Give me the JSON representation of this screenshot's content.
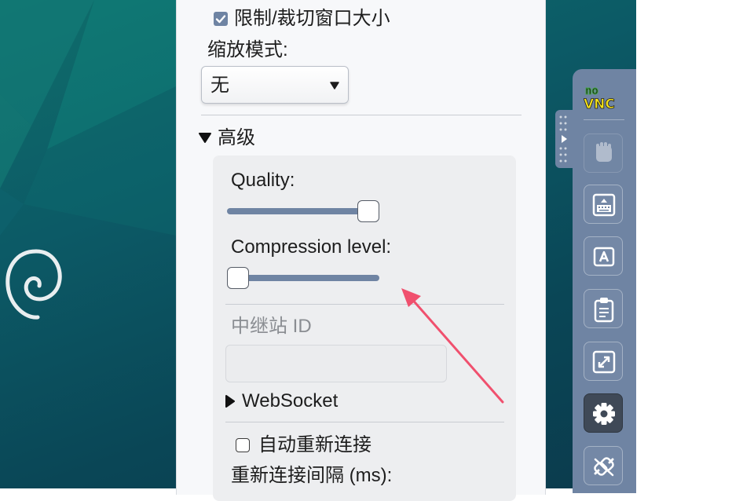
{
  "settings_panel": {
    "clip_checkbox": {
      "label": "限制/裁切窗口大小",
      "checked": true
    },
    "scaling_mode": {
      "label": "缩放模式:",
      "value": "无"
    },
    "advanced": {
      "label": "高级",
      "quality": {
        "label": "Quality:",
        "value_fraction": 0.9
      },
      "compression": {
        "label": "Compression level:",
        "value_fraction": 0.0
      },
      "repeater_id": {
        "label": "中继站 ID",
        "value": ""
      },
      "websocket": {
        "label": "WebSocket"
      },
      "auto_reconnect": {
        "label": "自动重新连接",
        "checked": false
      },
      "reconnect_delay": {
        "label": "重新连接间隔 (ms):"
      }
    }
  },
  "vnc_sidebar": {
    "logo": {
      "line1": "no",
      "line2": "VNC"
    },
    "buttons": [
      {
        "icon": "drag-hand-icon",
        "state": "disabled"
      },
      {
        "icon": "keyboard-icon",
        "state": "normal"
      },
      {
        "icon": "extra-keys-icon",
        "state": "normal"
      },
      {
        "icon": "clipboard-icon",
        "state": "normal"
      },
      {
        "icon": "fullscreen-icon",
        "state": "normal"
      },
      {
        "icon": "settings-gear-icon",
        "state": "active"
      },
      {
        "icon": "disconnect-icon",
        "state": "normal"
      }
    ]
  },
  "colors": {
    "accent": "#6f84a3",
    "annotation_arrow": "#f0506e",
    "desktop": "#0c5a66"
  }
}
